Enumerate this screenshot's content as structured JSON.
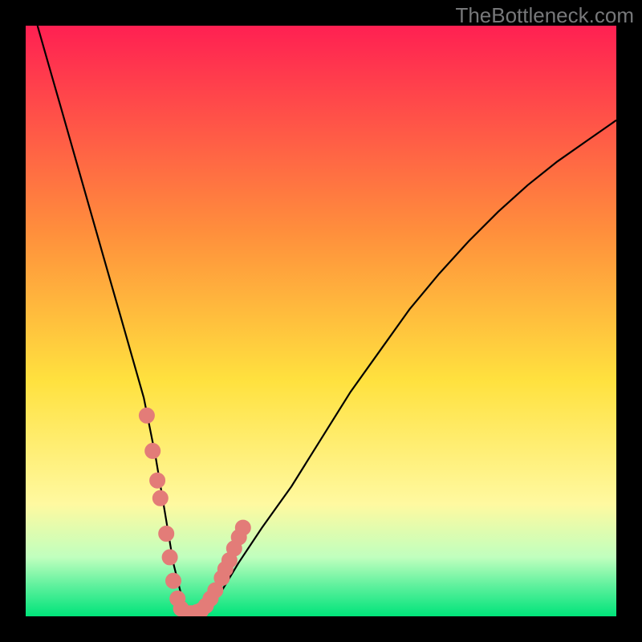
{
  "watermark": "TheBottleneck.com",
  "colors": {
    "frame": "#000000",
    "curve": "#000000",
    "marker_fill": "#e37c78",
    "marker_stroke": "#e37c78",
    "gradient_top": "#ff2052",
    "gradient_mid_upper": "#ff8f3c",
    "gradient_mid": "#ffe13e",
    "gradient_lower": "#fff9a0",
    "gradient_green_top": "#c0ffbe",
    "gradient_green_mid": "#5bf09c",
    "gradient_bottom": "#00e47a"
  },
  "chart_data": {
    "type": "line",
    "title": "",
    "xlabel": "",
    "ylabel": "",
    "xlim": [
      0,
      100
    ],
    "ylim": [
      0,
      100
    ],
    "series": [
      {
        "name": "bottleneck-curve",
        "x": [
          2,
          4,
          6,
          8,
          10,
          12,
          14,
          16,
          18,
          20,
          22,
          23.5,
          25,
          26.5,
          28,
          30,
          33,
          36,
          40,
          45,
          50,
          55,
          60,
          65,
          70,
          75,
          80,
          85,
          90,
          95,
          100
        ],
        "y": [
          100,
          93,
          86,
          79,
          72,
          65,
          58,
          51,
          44,
          37,
          27,
          18,
          9,
          3,
          0.5,
          1,
          4,
          9,
          15,
          22,
          30,
          38,
          45,
          52,
          58,
          63.5,
          68.5,
          73,
          77,
          80.5,
          84
        ]
      }
    ],
    "markers": {
      "name": "highlighted-points",
      "points": [
        {
          "x": 20.5,
          "y": 34
        },
        {
          "x": 21.5,
          "y": 28
        },
        {
          "x": 22.3,
          "y": 23
        },
        {
          "x": 22.8,
          "y": 20
        },
        {
          "x": 23.8,
          "y": 14
        },
        {
          "x": 24.4,
          "y": 10
        },
        {
          "x": 25.0,
          "y": 6
        },
        {
          "x": 25.7,
          "y": 3
        },
        {
          "x": 26.3,
          "y": 1.3
        },
        {
          "x": 27.3,
          "y": 0.5
        },
        {
          "x": 28.0,
          "y": 0.5
        },
        {
          "x": 29.0,
          "y": 0.7
        },
        {
          "x": 29.7,
          "y": 1.0
        },
        {
          "x": 30.5,
          "y": 1.8
        },
        {
          "x": 31.3,
          "y": 3.0
        },
        {
          "x": 32.1,
          "y": 4.4
        },
        {
          "x": 33.2,
          "y": 6.5
        },
        {
          "x": 33.8,
          "y": 8
        },
        {
          "x": 34.5,
          "y": 9.5
        },
        {
          "x": 35.3,
          "y": 11.5
        },
        {
          "x": 36.1,
          "y": 13.4
        },
        {
          "x": 36.8,
          "y": 15
        }
      ]
    }
  }
}
